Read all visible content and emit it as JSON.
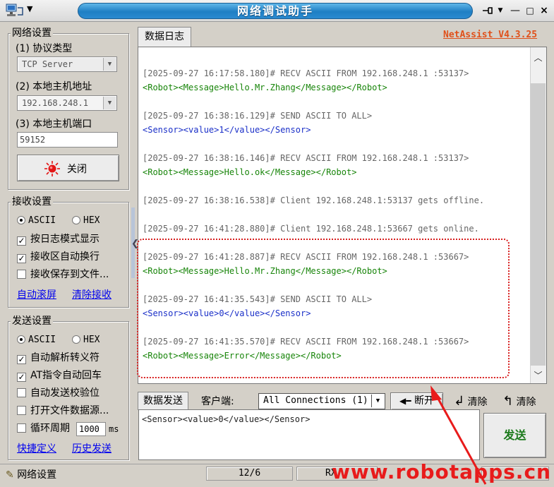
{
  "window": {
    "title": "网络调试助手",
    "version": "NetAssist V4.3.25",
    "minimize": "—",
    "close": "×"
  },
  "network": {
    "group_title": "网络设置",
    "protocol_label": "(1) 协议类型",
    "protocol_value": "TCP Server",
    "host_label": "(2) 本地主机地址",
    "host_value": "192.168.248.1",
    "port_label": "(3) 本地主机端口",
    "port_value": "59152",
    "close_button": "关闭"
  },
  "receive": {
    "group_title": "接收设置",
    "ascii": "ASCII",
    "hex": "HEX",
    "options": [
      {
        "label": "按日志模式显示",
        "checked": true
      },
      {
        "label": "接收区自动换行",
        "checked": true
      },
      {
        "label": "接收保存到文件...",
        "checked": false
      }
    ],
    "auto_scroll": "自动滚屏",
    "clear_receive": "清除接收"
  },
  "send_settings": {
    "group_title": "发送设置",
    "ascii": "ASCII",
    "hex": "HEX",
    "options": [
      {
        "label": "自动解析转义符",
        "checked": true
      },
      {
        "label": "AT指令自动回车",
        "checked": true
      },
      {
        "label": "自动发送校验位",
        "checked": false
      },
      {
        "label": "打开文件数据源...",
        "checked": false
      }
    ],
    "cycle_label": "循环周期",
    "cycle_value": "1000",
    "cycle_unit": "ms",
    "shortcut": "快捷定义",
    "history": "历史发送"
  },
  "log": {
    "tab": "数据日志",
    "entries": [
      {
        "head": "[2025-09-27 16:17:58.180]# RECV ASCII FROM 192.168.248.1 :53137>",
        "body": "<Robot><Message>Hello.Mr.Zhang</Message></Robot>",
        "kind": "recv"
      },
      {
        "head": "[2025-09-27 16:38:16.129]# SEND ASCII TO ALL>",
        "body": "<Sensor><value>1</value></Sensor>",
        "kind": "send"
      },
      {
        "head": "[2025-09-27 16:38:16.146]# RECV ASCII FROM 192.168.248.1 :53137>",
        "body": "<Robot><Message>Hello.ok</Message></Robot>",
        "kind": "recv"
      },
      {
        "head": "[2025-09-27 16:38:16.538]# Client 192.168.248.1:53137 gets offline.",
        "body": "",
        "kind": "info"
      },
      {
        "head": "[2025-09-27 16:41:28.880]# Client 192.168.248.1:53667 gets online.",
        "body": "",
        "kind": "info"
      },
      {
        "head": "[2025-09-27 16:41:28.887]# RECV ASCII FROM 192.168.248.1 :53667>",
        "body": "<Robot><Message>Hello.Mr.Zhang</Message></Robot>",
        "kind": "recv"
      },
      {
        "head": "[2025-09-27 16:41:35.543]# SEND ASCII TO ALL>",
        "body": "<Sensor><value>0</value></Sensor>",
        "kind": "send"
      },
      {
        "head": "[2025-09-27 16:41:35.570]# RECV ASCII FROM 192.168.248.1 :53667>",
        "body": "<Robot><Message>Error</Message></Robot>",
        "kind": "recv"
      }
    ]
  },
  "send_area": {
    "tab": "数据发送",
    "client_label": "客户端:",
    "client_value": "All Connections (1)",
    "disconnect": "断开",
    "clear1": "清除",
    "clear2": "清除",
    "text": "<Sensor><value>0</value></Sensor>",
    "send_button": "发送"
  },
  "status": {
    "settings": "网络设置",
    "count": "12/6",
    "rx": "RX"
  },
  "watermark": "www.robotapps.cn",
  "colors": {
    "recv": "#18850a",
    "send": "#1a2fc8",
    "version": "#e0501a",
    "annotation": "#e81b1b"
  }
}
